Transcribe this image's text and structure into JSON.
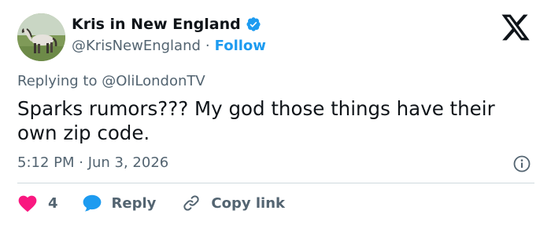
{
  "author": {
    "name": "Kris in New England",
    "handle": "@KrisNewEngland",
    "separator": "·",
    "follow_label": "Follow"
  },
  "icons": {
    "avatar": "horse-photo",
    "verified": "verified-badge-icon",
    "platform": "x-logo-icon",
    "info": "info-icon",
    "like": "heart-icon",
    "reply": "speech-bubble-icon",
    "copy": "link-icon"
  },
  "reply_context": {
    "prefix": "Replying to",
    "mention": "@OliLondonTV"
  },
  "tweet": {
    "text": "Sparks rumors??? My god those things have their own zip code.",
    "timestamp": "5:12 PM · Jun 3, 2026"
  },
  "actions": {
    "like_count": "4",
    "reply_label": "Reply",
    "copy_label": "Copy link"
  },
  "colors": {
    "accent": "#1d9bf0",
    "like": "#f91880",
    "text": "#0f1419",
    "muted": "#536471",
    "divider": "#cfd9de"
  }
}
